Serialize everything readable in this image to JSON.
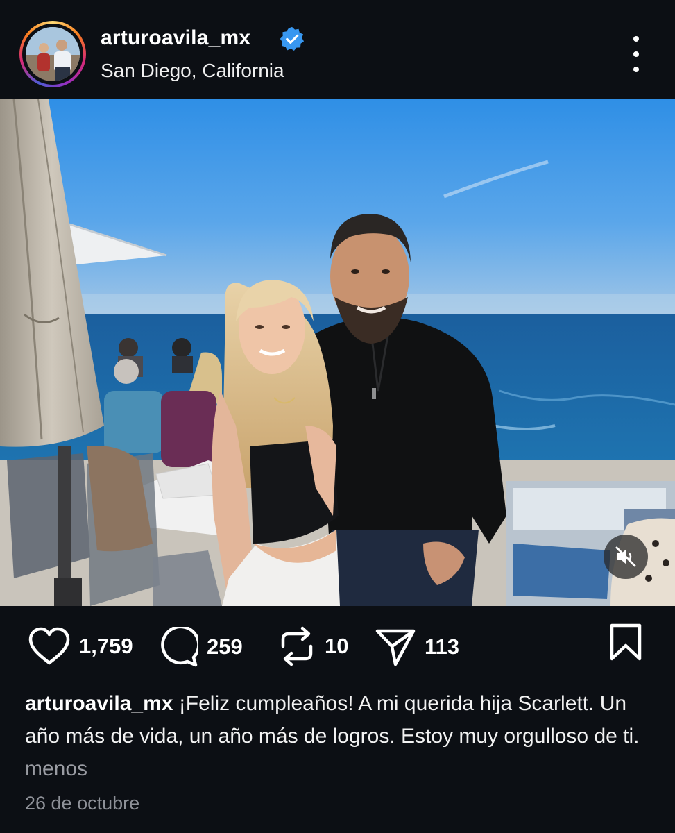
{
  "post": {
    "username": "arturoavila_mx",
    "location": "San Diego, California",
    "verified": true,
    "photo_description_icon": "post-photo",
    "accent_colors": {
      "verified": "#3897f0",
      "background": "#0c0f14"
    }
  },
  "actions": {
    "likes": "1,759",
    "comments": "259",
    "reposts": "10",
    "shares": "113"
  },
  "caption": {
    "username": "arturoavila_mx",
    "text": "¡Feliz cumpleaños! A mi querida hija Scarlett. Un año más de vida, un año más de logros. Estoy muy orgulloso de ti.",
    "less_label": "menos"
  },
  "date": "26 de octubre",
  "icons": {
    "more": "more-options-icon",
    "like": "heart-icon",
    "comment": "comment-bubble-icon",
    "repost": "repost-icon",
    "share": "send-icon",
    "save": "bookmark-icon",
    "mute": "muted-speaker-icon"
  }
}
